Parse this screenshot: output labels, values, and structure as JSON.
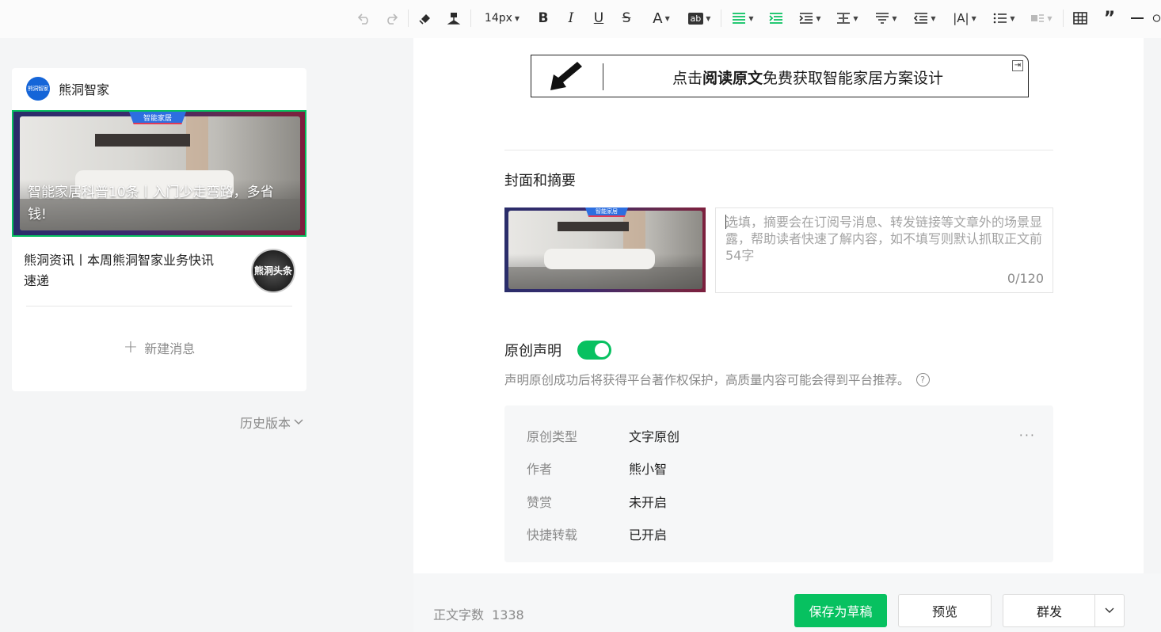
{
  "toolbar": {
    "font_size": "14px",
    "undo": "undo-icon",
    "redo": "redo-icon"
  },
  "account": {
    "avatar_text": "熊洞智家",
    "name": "熊洞智家"
  },
  "articles": {
    "main": {
      "tag": "智能家居",
      "title": "智能家居科普10条丨入门少走弯路，多省钱!"
    },
    "sub": {
      "title": "熊洞资讯丨本周熊洞智家业务快讯速递",
      "thumb_text": "熊洞头条"
    },
    "new_message": "新建消息",
    "plus": "+"
  },
  "history": {
    "label": "历史版本"
  },
  "editor": {
    "banner": {
      "prefix": "点击",
      "bold": "阅读原文",
      "suffix": "免费获取智能家居方案设计",
      "corner": "⇥"
    },
    "cover_section": {
      "title": "封面和摘要",
      "thumb_tag": "智能家居",
      "summary_placeholder": "选填，摘要会在订阅号消息、转发链接等文章外的场景显露，帮助读者快速了解内容，如不填写则默认抓取正文前54字",
      "summary_count": "0/120"
    },
    "original": {
      "label": "原创声明",
      "enabled": true,
      "desc": "声明原创成功后将获得平台著作权保护，高质量内容可能会得到平台推荐。",
      "help": "?",
      "rows": [
        {
          "key": "原创类型",
          "value": "文字原创"
        },
        {
          "key": "作者",
          "value": "熊小智"
        },
        {
          "key": "赞赏",
          "value": "未开启"
        },
        {
          "key": "快捷转载",
          "value": "已开启"
        }
      ],
      "more": "···"
    }
  },
  "footer": {
    "word_count_label": "正文字数",
    "word_count": "1338",
    "save_draft": "保存为草稿",
    "preview": "预览",
    "publish": "群发"
  },
  "colors": {
    "accent": "#07c160",
    "avatar": "#1565d8"
  }
}
